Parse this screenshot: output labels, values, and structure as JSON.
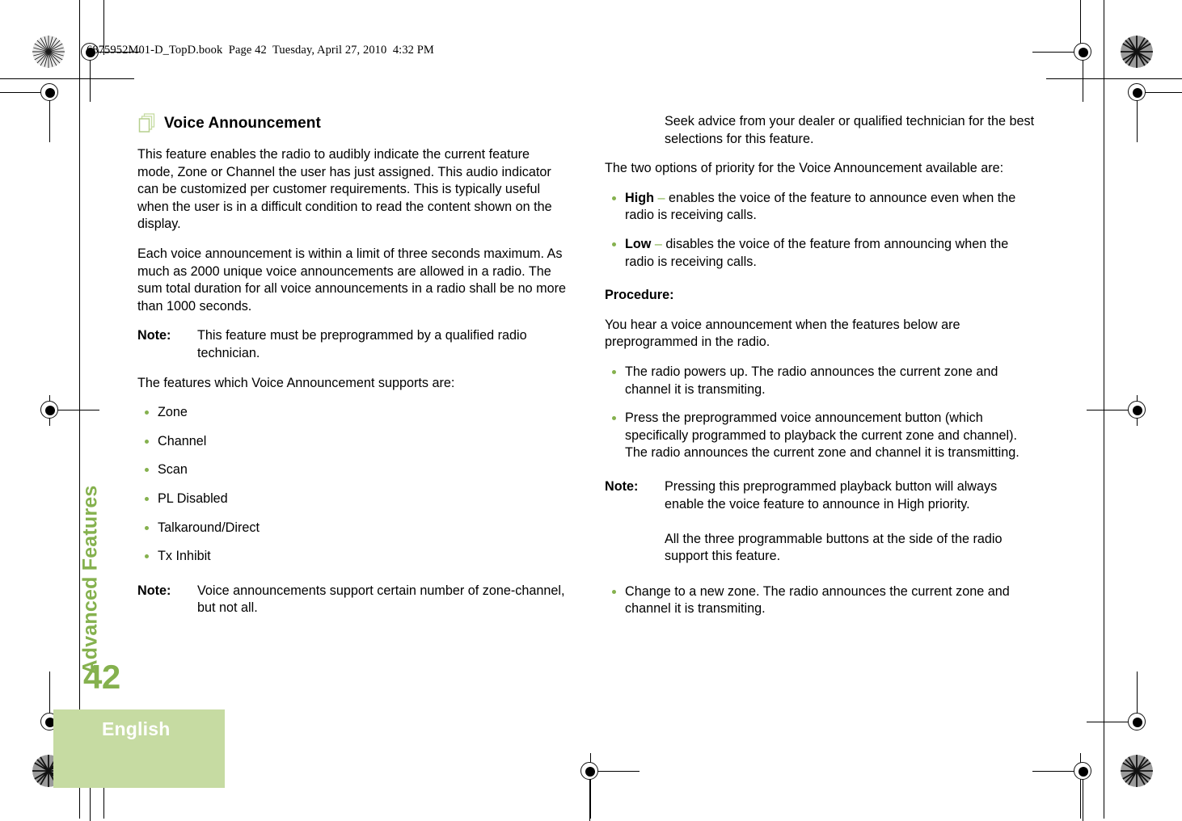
{
  "colors": {
    "accent_green": "#85b14e",
    "band_green": "#c6dba2",
    "icon_green": "#c6dba2",
    "text_black": "#000000",
    "band_text_white": "#ffffff"
  },
  "print_header": "6875952M01-D_TopD.book  Page 42  Tuesday, April 27, 2010  4:32 PM",
  "sidebar": {
    "chapter_title": "Advanced Features",
    "page_number": "42",
    "language_band": "English"
  },
  "left_column": {
    "heading": "Voice Announcement",
    "heading_icon": "stacked-pages-icon",
    "paragraph_1": "This feature enables the radio to audibly indicate the current feature mode, Zone or Channel the user has just assigned. This audio indicator can be customized per customer requirements. This is typically useful when the user is in a difficult condition to read the content shown on the display.",
    "paragraph_2": "Each voice announcement is within a limit of three seconds maximum. As much as 2000 unique voice announcements are allowed in a radio. The sum total duration for all voice announcements in a radio shall be no more than 1000 seconds.",
    "note_1": {
      "label": "Note:",
      "body": "This feature must be preprogrammed by a qualified radio technician."
    },
    "supports_intro": "The features which Voice Announcement supports are:",
    "supported_features": [
      "Zone",
      "Channel",
      "Scan",
      "PL Disabled",
      "Talkaround/Direct",
      "Tx Inhibit"
    ],
    "note_2": {
      "label": "Note:",
      "body": "Voice announcements support certain number of zone-channel, but not all."
    }
  },
  "right_column": {
    "note_continued": "Seek advice from your dealer or qualified technician for the best selections for this feature.",
    "priority_intro": "The two options of priority for the Voice Announcement available are:",
    "priority_options": [
      {
        "term": "High",
        "dash": "–",
        "description": "enables the voice of the feature to announce even when the radio is receiving calls."
      },
      {
        "term": "Low",
        "dash": "–",
        "description": "disables the voice of the feature from announcing when the radio is receiving calls."
      }
    ],
    "procedure_heading": "Procedure:",
    "procedure_intro": "You hear a voice announcement when the features below are preprogrammed in the radio.",
    "procedure_bullets_top": [
      "The radio powers up. The radio announces the current zone and channel it is transmiting.",
      "Press the preprogrammed voice announcement button (which specifically programmed to playback the current zone and channel). The radio announces the current zone and channel it is transmitting."
    ],
    "note_3": {
      "label": "Note:",
      "body_1": "Pressing this preprogrammed playback button will always enable the voice feature to announce in High priority.",
      "body_2": "All the three programmable buttons at the side of the radio support this feature."
    },
    "procedure_bullets_bottom": [
      "Change to a new zone. The radio announces the current zone and channel it is transmiting."
    ]
  }
}
